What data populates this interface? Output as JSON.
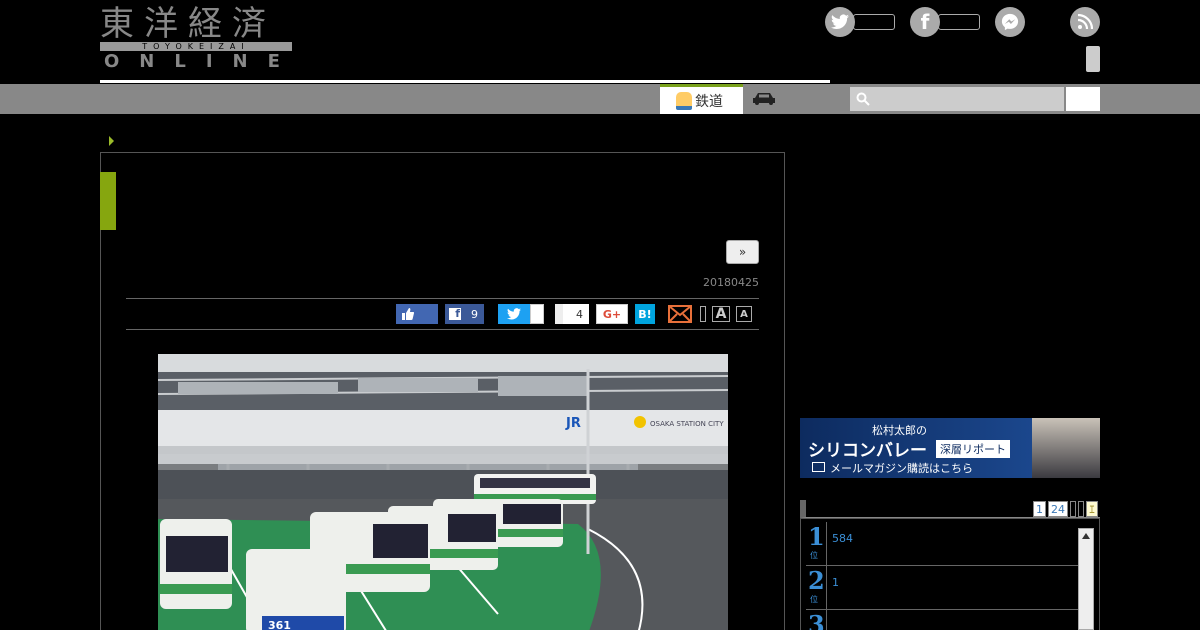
{
  "logo": {
    "kanji": "東洋経済",
    "romaji": "TOYOKEIZAI",
    "online": "ONLINE"
  },
  "nav": {
    "tab_rail": "鉄道"
  },
  "article": {
    "next_label": "»",
    "date": "20180425",
    "share": {
      "fb_count": "9",
      "pocket_count": "4",
      "gplus_label": "G+",
      "hatena_label": "B!",
      "font_large": "A",
      "font_small": "A"
    }
  },
  "banner": {
    "line1": "松村太郎の",
    "line2": "シリコンバレー",
    "line3": "深層リポート",
    "line4": "メールマガジン購読はこちら"
  },
  "ranking": {
    "tabs": [
      "1",
      "24",
      "",
      "",
      "ｴ"
    ],
    "items": [
      {
        "rank": "1",
        "sub": "位",
        "text": "584"
      },
      {
        "rank": "2",
        "sub": "位",
        "text": "1"
      },
      {
        "rank": "3",
        "sub": "位",
        "text": ""
      }
    ]
  },
  "photo_signs": {
    "jr": "JR",
    "city": "OSAKA STATION CITY",
    "bus_route": "361"
  }
}
